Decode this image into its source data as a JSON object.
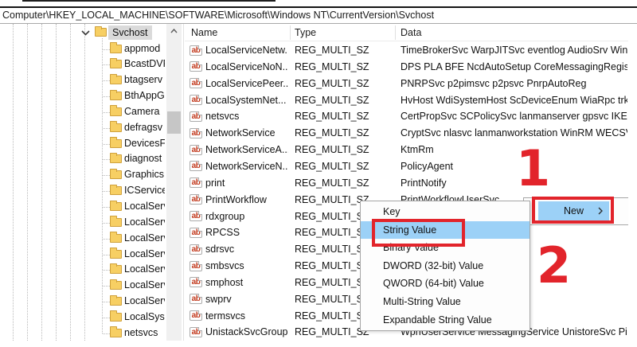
{
  "address_bar": {
    "path": "Computer\\HKEY_LOCAL_MACHINE\\SOFTWARE\\Microsoft\\Windows NT\\CurrentVersion\\Svchost"
  },
  "tree": {
    "root": {
      "label": "Svchost",
      "selected": true,
      "expanded": true
    },
    "children": [
      "appmod",
      "BcastDVR",
      "btagserv",
      "BthAppG",
      "Camera",
      "defragsv",
      "DevicesF",
      "diagnost",
      "Graphics",
      "ICService",
      "LocalServ",
      "LocalServ",
      "LocalServ",
      "LocalServ",
      "LocalServ",
      "LocalServ",
      "LocalServ",
      "LocalSyst",
      "netsvcs"
    ]
  },
  "list": {
    "columns": [
      "Name",
      "Type",
      "Data"
    ],
    "rows": [
      {
        "name": "LocalServiceNetw...",
        "type": "REG_MULTI_SZ",
        "data": "TimeBrokerSvc WarpJITSvc eventlog AudioSrv Win..."
      },
      {
        "name": "LocalServiceNoN...",
        "type": "REG_MULTI_SZ",
        "data": "DPS PLA BFE NcdAutoSetup CoreMessagingRegistr..."
      },
      {
        "name": "LocalServicePeer...",
        "type": "REG_MULTI_SZ",
        "data": "PNRPSvc p2pimsvc p2psvc PnrpAutoReg"
      },
      {
        "name": "LocalSystemNet...",
        "type": "REG_MULTI_SZ",
        "data": "HvHost WdiSystemHost ScDeviceEnum WiaRpc trk..."
      },
      {
        "name": "netsvcs",
        "type": "REG_MULTI_SZ",
        "data": "CertPropSvc SCPolicySvc lanmanserver gpsvc IKEEX..."
      },
      {
        "name": "NetworkService",
        "type": "REG_MULTI_SZ",
        "data": "CryptSvc nlasvc lanmanworkstation WinRM WECSV..."
      },
      {
        "name": "NetworkServiceA...",
        "type": "REG_MULTI_SZ",
        "data": "KtmRm"
      },
      {
        "name": "NetworkServiceN...",
        "type": "REG_MULTI_SZ",
        "data": "PolicyAgent"
      },
      {
        "name": "print",
        "type": "REG_MULTI_SZ",
        "data": "PrintNotify"
      },
      {
        "name": "PrintWorkflow",
        "type": "REG_MULTI_SZ",
        "data": "PrintWorkflowUserSvc"
      },
      {
        "name": "rdxgroup",
        "type": "REG_MULTI_SZ",
        "data": ""
      },
      {
        "name": "RPCSS",
        "type": "REG_MULTI_SZ",
        "data": ""
      },
      {
        "name": "sdrsvc",
        "type": "REG_MULTI_SZ",
        "data": ""
      },
      {
        "name": "smbsvcs",
        "type": "REG_MULTI_SZ",
        "data": ""
      },
      {
        "name": "smphost",
        "type": "REG_MULTI_SZ",
        "data": ""
      },
      {
        "name": "swprv",
        "type": "REG_MULTI_SZ",
        "data": ""
      },
      {
        "name": "termsvcs",
        "type": "REG_MULTI_SZ",
        "data": ""
      },
      {
        "name": "UnistackSvcGroup",
        "type": "REG_MULTI_SZ",
        "data": "WpnUserService MessagingService UnistoreSvc Pim"
      }
    ]
  },
  "context_menu": {
    "new_label": "New"
  },
  "context_submenu": {
    "items": [
      {
        "label": "Key",
        "highlighted": false
      },
      {
        "label": "String Value",
        "highlighted": true
      },
      {
        "label": "Binary Value",
        "highlighted": false
      },
      {
        "label": "DWORD (32-bit) Value",
        "highlighted": false
      },
      {
        "label": "QWORD (64-bit) Value",
        "highlighted": false
      },
      {
        "label": "Multi-String Value",
        "highlighted": false
      },
      {
        "label": "Expandable String Value",
        "highlighted": false
      }
    ]
  },
  "annotations": {
    "step1": "1",
    "step2": "2"
  },
  "icons": {
    "string_value_glyph": "ab"
  },
  "colors": {
    "selection_blue": "#9cd1f7",
    "annotation_red": "#e2242b",
    "tree_selected_gray": "#dadada",
    "menu_border": "#a6a6a6"
  }
}
